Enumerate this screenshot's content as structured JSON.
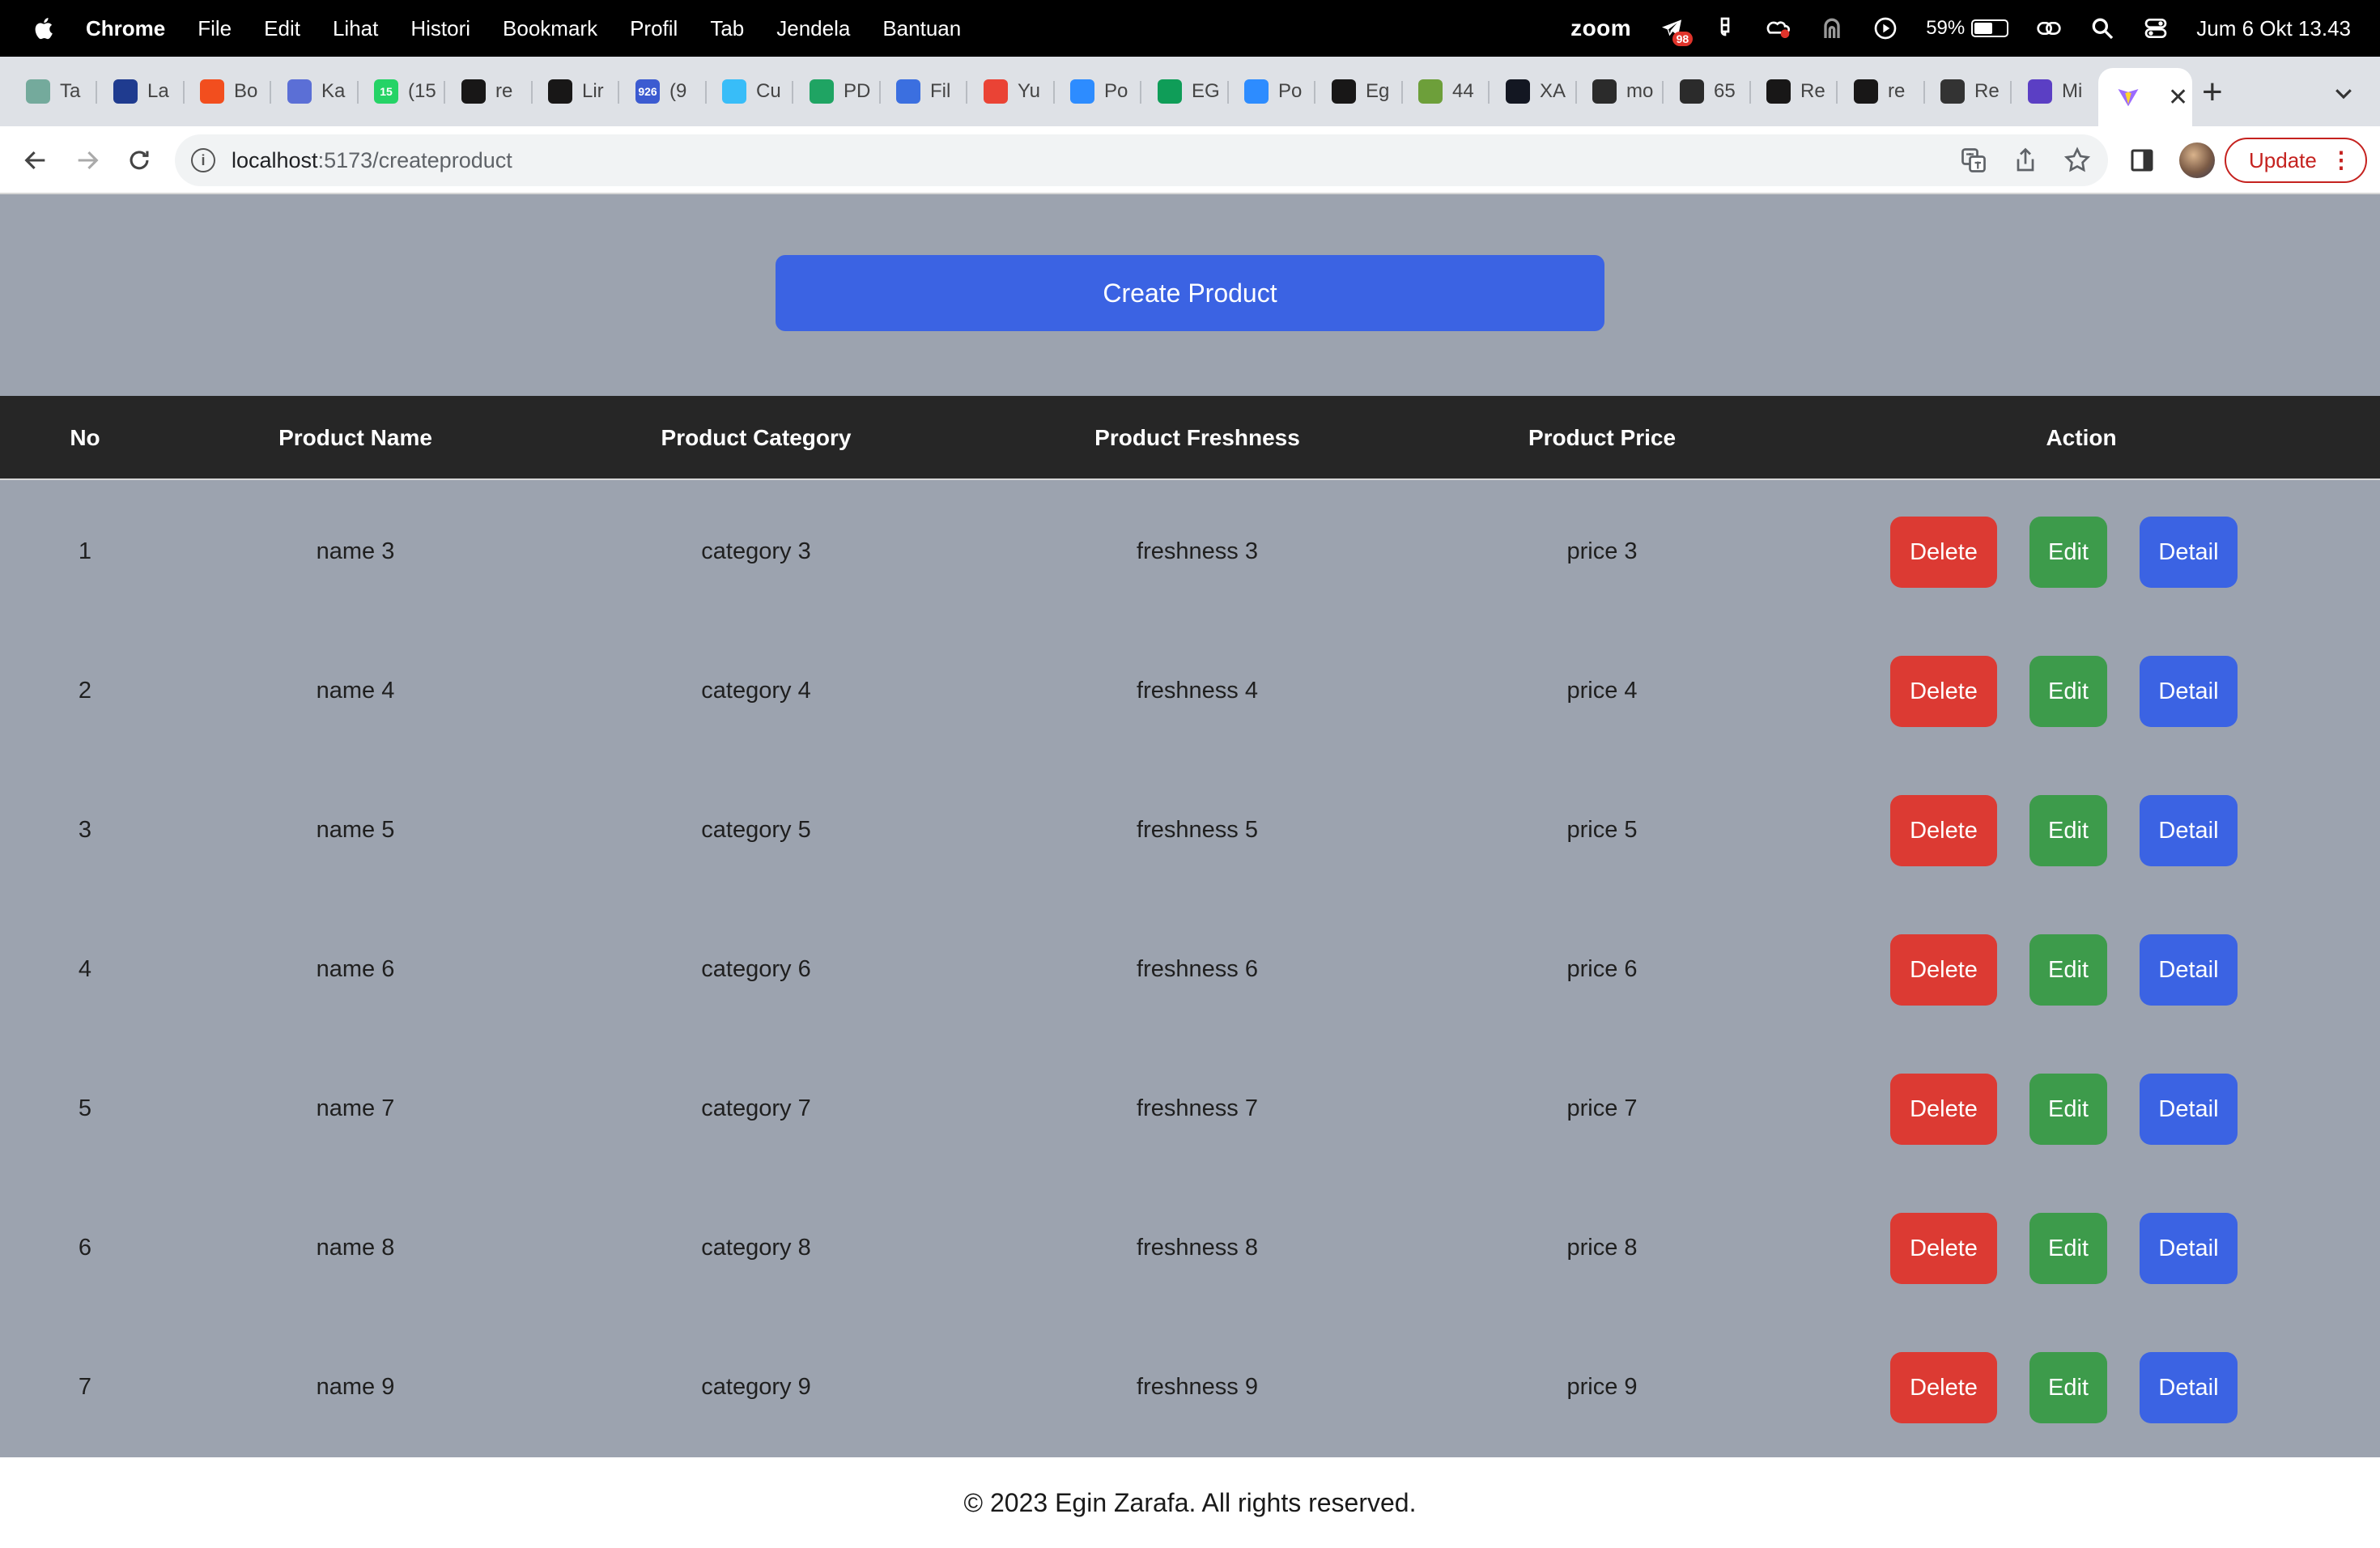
{
  "menubar": {
    "app_name": "Chrome",
    "menus": [
      "File",
      "Edit",
      "Lihat",
      "Histori",
      "Bookmark",
      "Profil",
      "Tab",
      "Jendela",
      "Bantuan"
    ],
    "zoom_label": "zoom",
    "notification_badge": "98",
    "battery_percent": "59%",
    "battery_level": 0.59,
    "clock": "Jum 6 Okt  13.43"
  },
  "tabs": [
    {
      "title": "Ta",
      "icon": "chatgpt-icon",
      "color": "#74aa9c"
    },
    {
      "title": "La",
      "icon": "ond-icon",
      "color": "#1f3b8f"
    },
    {
      "title": "Bo",
      "icon": "figma-icon",
      "color": "#f24e1e"
    },
    {
      "title": "Ka",
      "icon": "kampus-icon",
      "color": "#5b6fd6"
    },
    {
      "title": "(15",
      "icon": "whatsapp-icon",
      "color": "#25d366",
      "badge": "15"
    },
    {
      "title": "re",
      "icon": "github-icon",
      "color": "#181717"
    },
    {
      "title": "Lir",
      "icon": "github-icon",
      "color": "#181717"
    },
    {
      "title": "(9",
      "icon": "mail-icon",
      "color": "#3c5bd1",
      "badge": "926"
    },
    {
      "title": "Cu",
      "icon": "tailwind-icon",
      "color": "#38bdf8"
    },
    {
      "title": "PD",
      "icon": "drive-icon",
      "color": "#1fa463"
    },
    {
      "title": "Fil",
      "icon": "forms-icon",
      "color": "#3b6fe0"
    },
    {
      "title": "Yu",
      "icon": "gmail-icon",
      "color": "#ea4335"
    },
    {
      "title": "Po",
      "icon": "zoom-icon",
      "color": "#2d8cff"
    },
    {
      "title": "EG",
      "icon": "sheets-icon",
      "color": "#0f9d58"
    },
    {
      "title": "Po",
      "icon": "zoom-icon",
      "color": "#2d8cff"
    },
    {
      "title": "Eg",
      "icon": "github-icon",
      "color": "#181717"
    },
    {
      "title": "44",
      "icon": "vite-icon",
      "color": "#6d9f3a"
    },
    {
      "title": "XA",
      "icon": "tradingview-icon",
      "color": "#131722"
    },
    {
      "title": "mo",
      "icon": "mockapi-icon",
      "color": "#2b2b2b"
    },
    {
      "title": "65",
      "icon": "mockapi-icon",
      "color": "#2b2b2b"
    },
    {
      "title": "Re",
      "icon": "github-icon",
      "color": "#181717"
    },
    {
      "title": "re",
      "icon": "github-icon",
      "color": "#181717"
    },
    {
      "title": "Re",
      "icon": "monitor-icon",
      "color": "#333333"
    },
    {
      "title": "Mi",
      "icon": "notes-icon",
      "color": "#5b3fc4"
    }
  ],
  "active_tab": {
    "icon": "vite-icon"
  },
  "address": {
    "host": "localhost",
    "path": ":5173/createproduct"
  },
  "toolbar": {
    "update_label": "Update"
  },
  "page": {
    "create_button": "Create Product",
    "columns": [
      "No",
      "Product Name",
      "Product Category",
      "Product Freshness",
      "Product Price",
      "Action"
    ],
    "actions": {
      "delete": "Delete",
      "edit": "Edit",
      "detail": "Detail"
    },
    "rows": [
      {
        "no": "1",
        "name": "name 3",
        "category": "category 3",
        "freshness": "freshness 3",
        "price": "price 3"
      },
      {
        "no": "2",
        "name": "name 4",
        "category": "category 4",
        "freshness": "freshness 4",
        "price": "price 4"
      },
      {
        "no": "3",
        "name": "name 5",
        "category": "category 5",
        "freshness": "freshness 5",
        "price": "price 5"
      },
      {
        "no": "4",
        "name": "name 6",
        "category": "category 6",
        "freshness": "freshness 6",
        "price": "price 6"
      },
      {
        "no": "5",
        "name": "name 7",
        "category": "category 7",
        "freshness": "freshness 7",
        "price": "price 7"
      },
      {
        "no": "6",
        "name": "name 8",
        "category": "category 8",
        "freshness": "freshness 8",
        "price": "price 8"
      },
      {
        "no": "7",
        "name": "name 9",
        "category": "category 9",
        "freshness": "freshness 9",
        "price": "price 9"
      }
    ],
    "footer": "© 2023 Egin Zarafa. All rights reserved."
  },
  "colors": {
    "page_bg": "#9ca3af",
    "header_bg": "#262626",
    "primary": "#3b63e3",
    "danger": "#dc3a33",
    "success": "#3d9b4b"
  }
}
